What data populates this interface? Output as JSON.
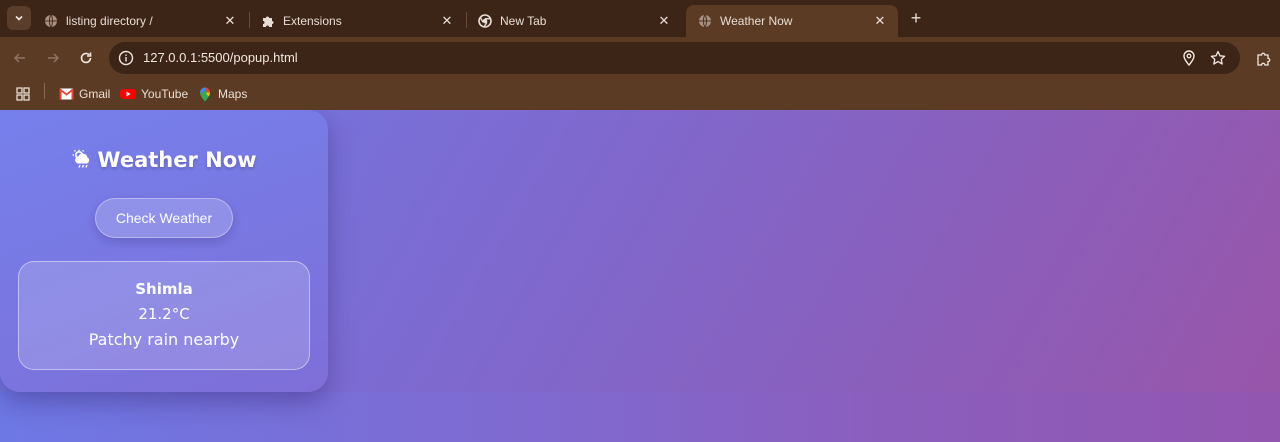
{
  "browser": {
    "tabs": [
      {
        "title": "listing directory /",
        "icon": "globe-icon",
        "active": false
      },
      {
        "title": "Extensions",
        "icon": "puzzle-icon",
        "active": false
      },
      {
        "title": "New Tab",
        "icon": "chrome-icon",
        "active": false
      },
      {
        "title": "Weather Now",
        "icon": "globe-icon",
        "active": true
      }
    ],
    "url": "127.0.0.1:5500/popup.html",
    "bookmarks": [
      {
        "label": "Gmail",
        "icon": "gmail-icon"
      },
      {
        "label": "YouTube",
        "icon": "youtube-icon"
      },
      {
        "label": "Maps",
        "icon": "maps-icon"
      }
    ],
    "colors": {
      "frame": "#3c2516",
      "toolbar": "#5c3b24"
    }
  },
  "popup": {
    "title": "Weather Now",
    "title_icon": "cloud-sun-rain-icon",
    "check_button": "Check Weather",
    "result": {
      "city": "Shimla",
      "temperature": "21.2°C",
      "condition": "Patchy rain nearby"
    },
    "colors": {
      "gradient_start": "#6e7ce6",
      "gradient_end": "#9955a8"
    }
  }
}
